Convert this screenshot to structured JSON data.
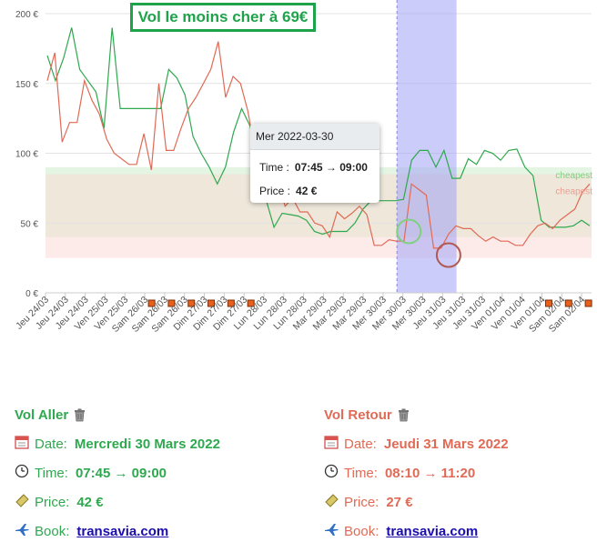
{
  "banner": "Vol le moins cher à 69€",
  "tooltip": {
    "header": "Mer 2022-03-30",
    "time_label": "Time :",
    "time_value": "07:45 → 09:00",
    "price_label": "Price :",
    "price_value": "42 €"
  },
  "colors": {
    "outbound": "#2fa84f",
    "return": "#e06a55",
    "highlight": "#a3a3f5",
    "band_green": "#e4f5e4",
    "band_red": "#fbe4e1",
    "band_mixed": "#eee7da"
  },
  "chart_data": {
    "type": "line",
    "ylim": [
      0,
      200
    ],
    "yticks": [
      "0 €",
      "50 €",
      "100 €",
      "150 €",
      "200 €"
    ],
    "ytick_values": [
      0,
      50,
      100,
      150,
      200
    ],
    "x_labels": [
      "Jeu 24/03",
      "Jeu 24/03",
      "Jeu 24/03",
      "Ven 25/03",
      "Ven 25/03",
      "Sam 26/03",
      "Sam 26/03",
      "Sam 26/03",
      "Dim 27/03",
      "Dim 27/03",
      "Dim 27/03",
      "Lun 28/03",
      "Lun 28/03",
      "Lun 28/03",
      "Mar 29/03",
      "Mar 29/03",
      "Mar 29/03",
      "Mer 30/03",
      "Mer 30/03",
      "Mer 30/03",
      "Jeu 31/03",
      "Jeu 31/03",
      "Jeu 31/03",
      "Ven 01/04",
      "Ven 01/04",
      "Ven 01/04",
      "Sam 02/04",
      "Sam 02/04"
    ],
    "weekend_markers": [
      5,
      6,
      7,
      8,
      9,
      10,
      25,
      26,
      27
    ],
    "bands": [
      {
        "name": "cheapest",
        "color": "green",
        "from": 40,
        "to": 90
      },
      {
        "name": "cheapest",
        "color": "red",
        "from": 25,
        "to": 85
      }
    ],
    "band_labels": [
      "cheapest",
      "cheapest"
    ],
    "highlight_range": [
      17.7,
      20.7
    ],
    "series": [
      {
        "values": [
          170,
          152,
          168,
          190,
          160,
          152,
          144,
          118,
          190,
          132,
          132,
          132,
          132,
          132,
          132,
          160,
          154,
          142,
          112,
          100,
          90,
          78,
          90,
          115,
          132,
          120,
          100,
          67,
          47,
          57,
          56,
          55,
          52,
          44,
          42,
          44,
          44,
          44,
          50,
          60,
          66,
          66,
          66,
          66,
          67,
          95,
          102,
          102,
          90,
          102,
          82,
          82,
          96,
          92,
          102,
          100,
          95,
          102,
          103,
          90,
          84,
          52,
          47,
          47,
          47,
          48,
          52,
          48
        ]
      },
      {
        "values": [
          152,
          172,
          108,
          122,
          122,
          152,
          138,
          128,
          110,
          100,
          96,
          92,
          92,
          114,
          88,
          150,
          102,
          102,
          118,
          132,
          140,
          150,
          160,
          180,
          140,
          155,
          150,
          130,
          100,
          90,
          100,
          80,
          62,
          68,
          58,
          58,
          50,
          48,
          40,
          58,
          53,
          57,
          62,
          56,
          34,
          34,
          38,
          37,
          37,
          78,
          74,
          70,
          32,
          32,
          42,
          48,
          46,
          46,
          41,
          37,
          40,
          37,
          37,
          34,
          34,
          42,
          48,
          50,
          46,
          52,
          56,
          60,
          72,
          78
        ]
      }
    ],
    "markers": [
      {
        "x_pos": 18.3,
        "y": 44,
        "color": "green"
      },
      {
        "x_pos": 20.3,
        "y": 27,
        "color": "red"
      }
    ]
  },
  "outbound": {
    "title": "Vol Aller",
    "date_label": "Date:",
    "date_value": "Mercredi 30 Mars 2022",
    "time_label": "Time:",
    "time_value": "07:45 → 09:00",
    "price_label": "Price:",
    "price_value": "42 €",
    "book_label": "Book:",
    "book_link": "transavia.com",
    "icons": [
      "trash-icon",
      "calendar-icon",
      "clock-icon",
      "money-icon",
      "airplane-icon"
    ]
  },
  "return": {
    "title": "Vol Retour",
    "date_label": "Date:",
    "date_value": "Jeudi 31 Mars 2022",
    "time_label": "Time:",
    "time_value": "08:10 → 11:20",
    "price_label": "Price:",
    "price_value": "27 €",
    "book_label": "Book:",
    "book_link": "transavia.com",
    "icons": [
      "trash-icon",
      "calendar-icon",
      "clock-icon",
      "money-icon",
      "airplane-icon"
    ]
  }
}
